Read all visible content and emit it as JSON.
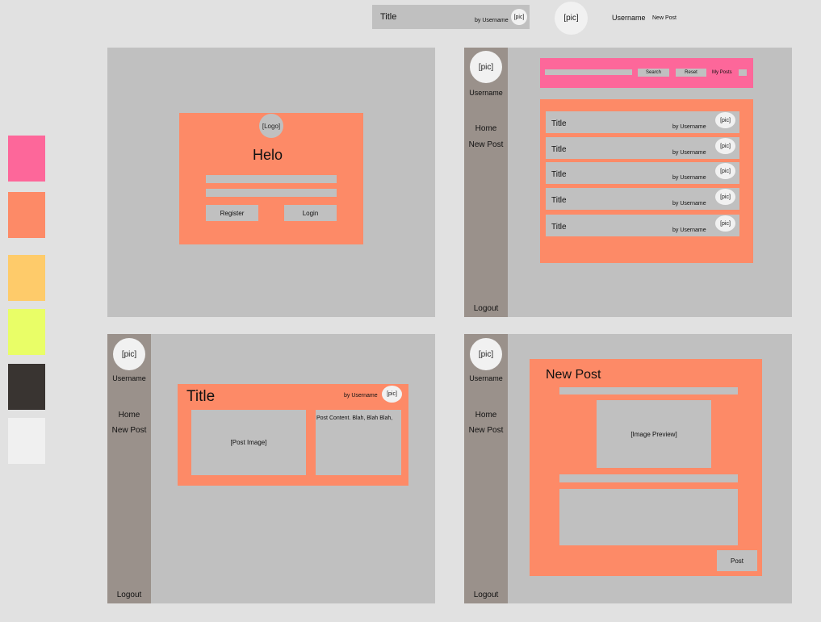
{
  "palette": [
    {
      "name": "pink",
      "hex": "#fd679a"
    },
    {
      "name": "orange",
      "hex": "#fd8a67"
    },
    {
      "name": "yellow",
      "hex": "#fecb6a"
    },
    {
      "name": "lime",
      "hex": "#e9fe67"
    },
    {
      "name": "dark",
      "hex": "#393431"
    },
    {
      "name": "light",
      "hex": "#f0f0f0"
    }
  ],
  "components": {
    "post_title": "Title",
    "by_user": "by Username",
    "pic": "[pic]",
    "username": "Username",
    "new_post": "New Post"
  },
  "login": {
    "logo": "[Logo]",
    "greeting": "Helo",
    "register": "Register",
    "login": "Login"
  },
  "sidebar": {
    "pic": "[pic]",
    "username": "Username",
    "home": "Home",
    "new_post": "New Post",
    "logout": "Logout"
  },
  "feed": {
    "search": "Search",
    "reset": "Reset",
    "my_posts": "My Posts",
    "posts": [
      {
        "title": "Title",
        "by": "by Username",
        "pic": "[pic]"
      },
      {
        "title": "Title",
        "by": "by Username",
        "pic": "[pic]"
      },
      {
        "title": "Title",
        "by": "by Username",
        "pic": "[pic]"
      },
      {
        "title": "Title",
        "by": "by Username",
        "pic": "[pic]"
      },
      {
        "title": "Title",
        "by": "by Username",
        "pic": "[pic]"
      }
    ]
  },
  "post_view": {
    "title": "Title",
    "by": "by Username",
    "pic": "[pic]",
    "image": "[Post Image]",
    "content": "Post Content. Blah, Blah Blah,"
  },
  "new_post_view": {
    "heading": "New Post",
    "image_preview": "[Image Preview]",
    "post_button": "Post"
  }
}
